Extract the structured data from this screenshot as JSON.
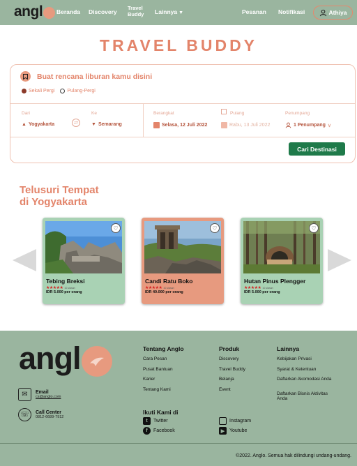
{
  "nav": {
    "logo": "angl",
    "links": [
      "Beranda",
      "Discovery"
    ],
    "travel_buddy": [
      "Travel",
      "Buddy"
    ],
    "more": "Lainnya",
    "orders": "Pesanan",
    "notifications": "Notifikasi",
    "user": "Athiya"
  },
  "page": {
    "title": "TRAVEL BUDDY"
  },
  "booking": {
    "heading": "Buat rencana liburan kamu disini",
    "trip_types": [
      "Sekali Pergi",
      "Pulang-Pergi"
    ],
    "from_label": "Dari",
    "from_value": "Yogyakarta",
    "to_label": "Ke",
    "to_value": "Semarang",
    "depart_label": "Berangkat",
    "depart_value": "Selasa, 12 Juli 2022",
    "return_label": "Pulang",
    "return_value": "Rabu, 13 Juli 2022",
    "passengers_label": "Penumpang",
    "passengers_value": "1 Penumpang",
    "search_button": "Cari Destinasi"
  },
  "explore": {
    "title_line1": "Telusuri Tempat",
    "title_line2": "di Yogyakarta",
    "cards": [
      {
        "name": "Tebing Breksi",
        "rating": "★★★★★",
        "views": "10 ulasan",
        "price": "IDR 5.000 per orang",
        "bg": "#a9d2b4"
      },
      {
        "name": "Candi Ratu Boko",
        "rating": "★★★★★",
        "views": "10 ulasan",
        "price": "IDR 40.000 per orang",
        "bg": "#e79a7f"
      },
      {
        "name": "Hutan Pinus Plengger",
        "rating": "★★★★★",
        "views": "10 ulasan",
        "price": "IDR 5.000 per orang",
        "bg": "#a9d2b4"
      }
    ]
  },
  "footer": {
    "logo": "angl",
    "email_title": "Email",
    "email_value": "cs@anglo.com",
    "call_title": "Call Center",
    "call_value": "0812-6689-7912",
    "about_title": "Tentang Anglo",
    "about_items": [
      "Cara Pesan",
      "Pusat Bantuan",
      "Karier",
      "Tentang Kami"
    ],
    "product_title": "Produk",
    "product_items": [
      "Discovery",
      "Travel Buddy",
      "Belanja",
      "Event"
    ],
    "other_title": "Lainnya",
    "other_items": [
      "Kebijakan Privasi",
      "Syarat & Ketentuan",
      "Daftarkan Akomodasi Anda",
      "Daftarkan Bisnis Aktivitas Anda"
    ],
    "follow_title": "Ikuti Kami di",
    "socials": [
      "Twitter",
      "Facebook",
      "Instagram",
      "Youtube"
    ],
    "copyright": "2022. Anglo. Semua hak dilindungi undang-undang."
  },
  "colors": {
    "accent": "#e3846a",
    "brand_green": "#9ab59f",
    "button": "#1f7a4a"
  }
}
